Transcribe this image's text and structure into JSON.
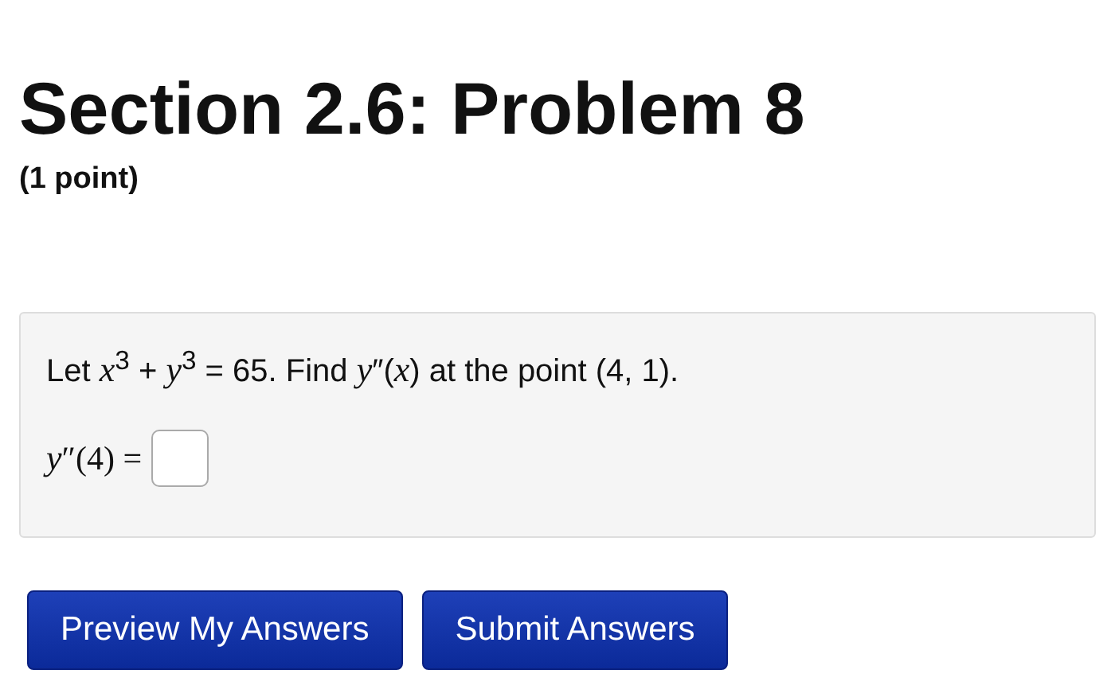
{
  "title": "Section 2.6: Problem 8",
  "points": "(1 point)",
  "problem": {
    "statement": "Let *x*$^{3}$ + *y*$^{3}$ = 65. Find *y*″(*x*) at the point (4, 1).",
    "answer_label": "*y*″(4) ="
  },
  "buttons": [
    "Preview My Answers",
    "Submit Answers"
  ]
}
